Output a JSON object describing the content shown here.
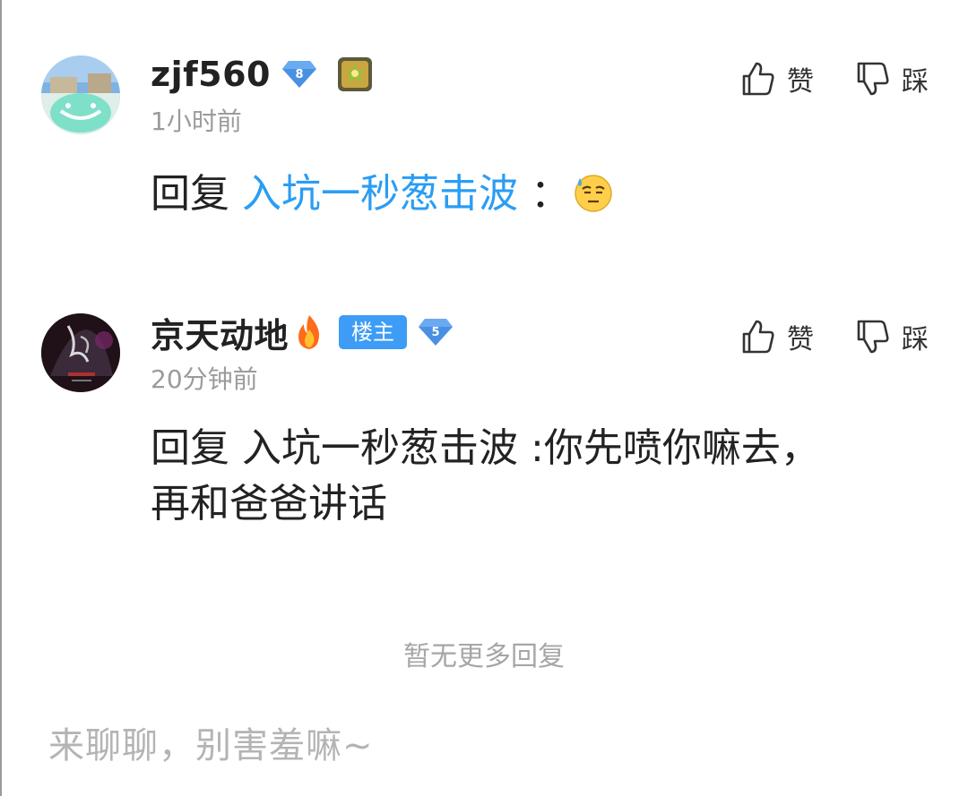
{
  "comments": [
    {
      "username": "zjf560",
      "level": "8",
      "time": "1小时前",
      "reply_prefix": "回复",
      "reply_target": "入坑一秒葱击波",
      "separator": "：",
      "message": "",
      "emoji": "sweat-emoji",
      "like_label": "赞",
      "dislike_label": "踩",
      "avatar_icon": "avatar-photo-mask",
      "badge_icon": "medal-icon"
    },
    {
      "username": "京天动地",
      "level": "5",
      "owner_tag": "楼主",
      "time": "20分钟前",
      "reply_prefix": "回复",
      "reply_target": "入坑一秒葱击波",
      "separator": ":",
      "message_line1": "你先喷你嘛去，",
      "message_line2": "再和爸爸讲话",
      "like_label": "赞",
      "dislike_label": "踩",
      "avatar_icon": "avatar-dark-poster",
      "badge_icon": "fire-icon"
    }
  ],
  "footer": {
    "no_more": "暂无更多回复",
    "composer_placeholder": "来聊聊，别害羞嘛~"
  },
  "colors": {
    "mention": "#2a9df4",
    "owner_tag": "#3d9cf5",
    "level_badge": "#4a90e2",
    "muted": "#9b9b9b"
  }
}
